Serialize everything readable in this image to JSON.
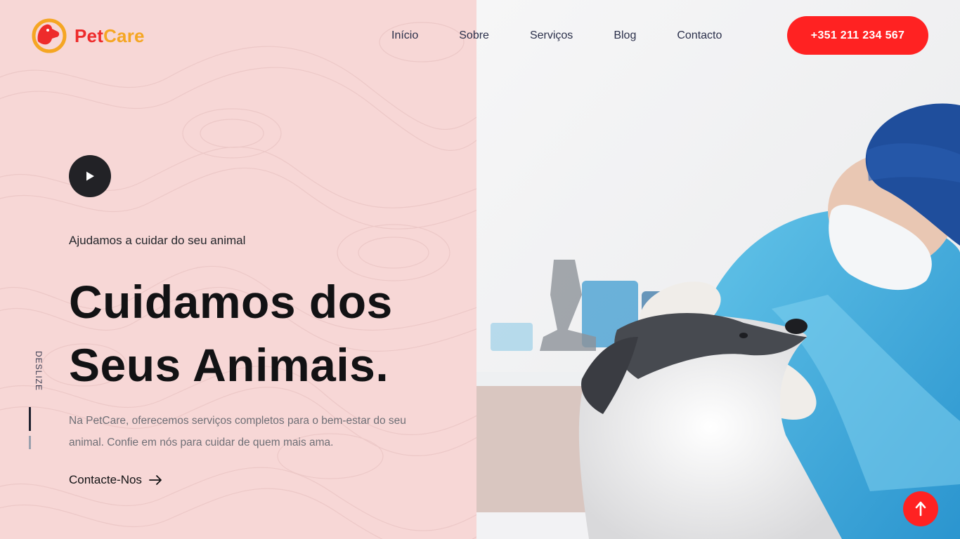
{
  "brand": {
    "name_part1": "Pet",
    "name_part2": "Care",
    "logo_icon": "dog-cat-logo-icon",
    "primary_color": "#ff2222",
    "secondary_color": "#f5a623"
  },
  "nav": {
    "items": [
      {
        "label": "Início"
      },
      {
        "label": "Sobre"
      },
      {
        "label": "Serviços"
      },
      {
        "label": "Blog"
      },
      {
        "label": "Contacto"
      }
    ]
  },
  "header": {
    "phone_label": "+351 211 234 567"
  },
  "hero": {
    "play_icon": "play-icon",
    "subtitle": "Ajudamos a cuidar do seu animal",
    "headline_line1": "Cuidamos dos",
    "headline_line2": "Seus Animais.",
    "description": "Na PetCare, oferecemos serviços completos para o bem-estar do seu animal. Confie em nós para cuidar de quem mais ama.",
    "cta_label": "Contacte-Nos",
    "cta_icon": "arrow-right-icon",
    "scroll_label": "DESLIZE",
    "image_subject": "veterinarian-examining-dog-photo",
    "background_color": "#f7d7d6"
  },
  "scroll_top": {
    "icon": "arrow-up-icon"
  }
}
